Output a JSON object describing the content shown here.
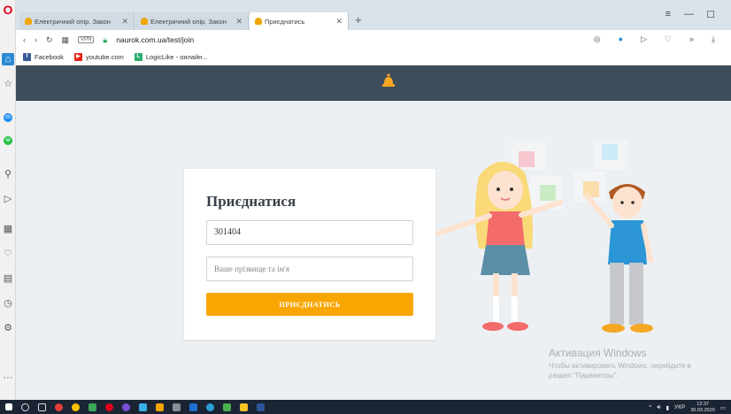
{
  "browser": {
    "tabs": [
      {
        "title": "Електричний опір. Закон"
      },
      {
        "title": "Електричний опір. Закон"
      },
      {
        "title": "Приєднатись"
      }
    ],
    "url": "naurok.com.ua/test/join",
    "vpn_label": "VPN",
    "bookmarks": [
      {
        "label": "Facebook"
      },
      {
        "label": "youtube.com"
      },
      {
        "label": "LogicLike - онлайн..."
      }
    ]
  },
  "join_form": {
    "heading": "Приєднатися",
    "code_value": "301404",
    "name_placeholder": "Ваше прізвище та ім'я",
    "button_label": "ПРИЄДНАТИСЬ"
  },
  "watermark": {
    "title": "Активация Windows",
    "line1": "Чтобы активировать Windows, перейдите в",
    "line2": "раздел \"Параметры\"."
  },
  "taskbar": {
    "language": "УКР",
    "time": "12:37",
    "date": "30.03.2020"
  },
  "colors": {
    "accent": "#f9a602",
    "header": "#3e4d5c",
    "page_bg": "#edf0f3"
  }
}
